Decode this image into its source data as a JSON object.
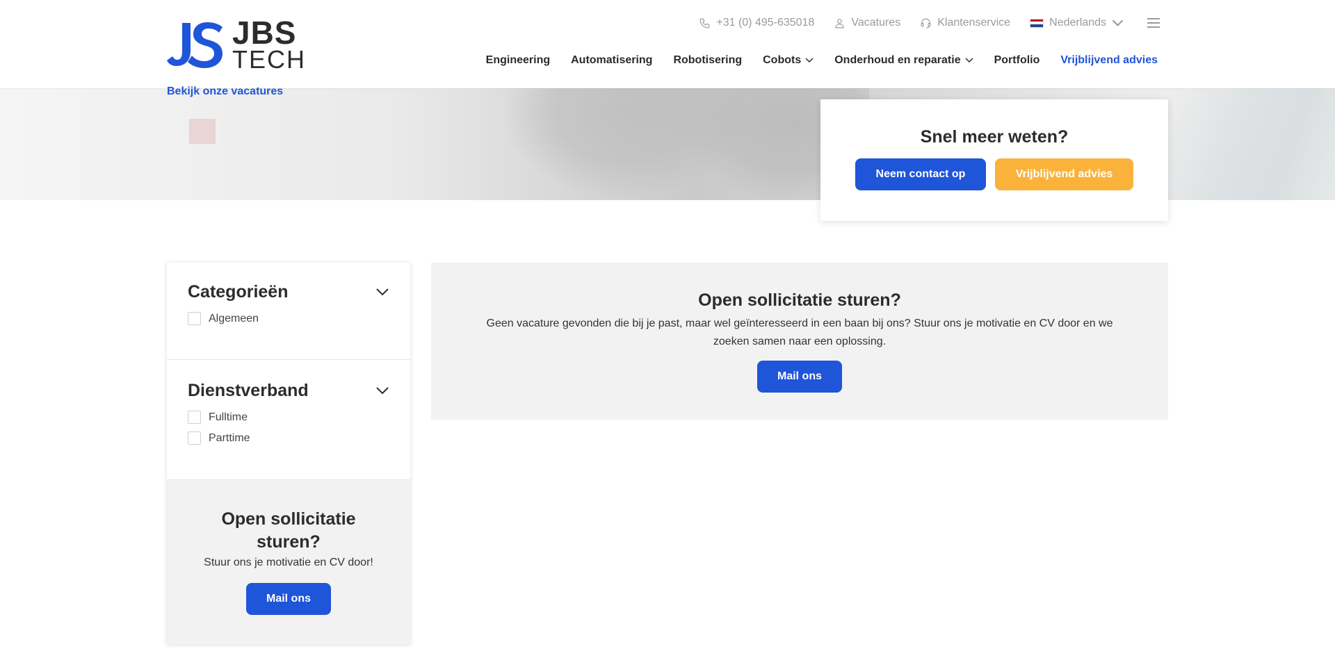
{
  "brand": {
    "logo_line1": "JBS",
    "logo_line2": "TECH",
    "accent_color": "#1f55d8",
    "secondary_color": "#fbb23a"
  },
  "topbar": {
    "phone": "+31 (0) 495-635018",
    "vacatures": "Vacatures",
    "klantenservice": "Klantenservice",
    "language": "Nederlands"
  },
  "nav": {
    "items": [
      {
        "label": "Engineering"
      },
      {
        "label": "Automatisering"
      },
      {
        "label": "Robotisering"
      },
      {
        "label": "Cobots"
      },
      {
        "label": "Onderhoud en reparatie"
      },
      {
        "label": "Portfolio"
      },
      {
        "label": "Vrijblijvend advies"
      }
    ]
  },
  "hero": {
    "link": "Bekijk onze vacatures"
  },
  "cta_card": {
    "title": "Snel meer weten?",
    "contact_label": "Neem contact op",
    "advice_label": "Vrijblijvend advies"
  },
  "filters": {
    "categories": {
      "title": "Categorieën",
      "options": [
        "Algemeen"
      ]
    },
    "dienstverband": {
      "title": "Dienstverband",
      "options": [
        "Fulltime",
        "Parttime"
      ]
    }
  },
  "sidebar_cta": {
    "title": "Open sollicitatie sturen?",
    "text": "Stuur ons je motivatie en CV door!",
    "button": "Mail ons"
  },
  "main": {
    "title": "Open sollicitatie sturen?",
    "text": "Geen vacature gevonden die bij je past, maar wel geïnteresseerd in een baan bij ons? Stuur ons je motivatie en CV door en we zoeken samen naar een oplossing.",
    "button": "Mail ons"
  }
}
